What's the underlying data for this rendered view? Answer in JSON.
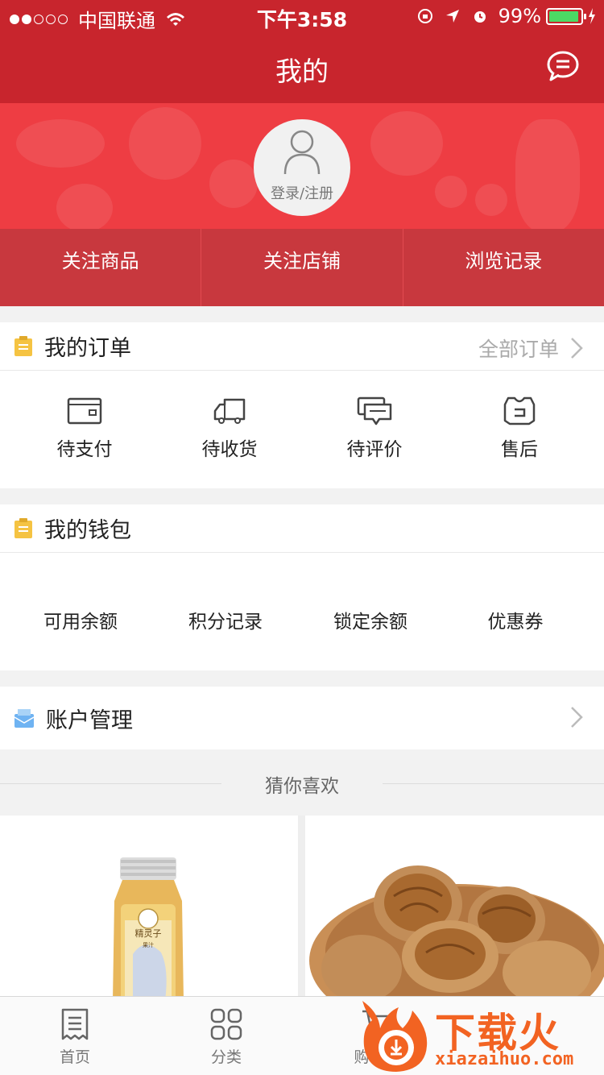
{
  "status_bar": {
    "carrier": "中国联通",
    "time": "下午3:58",
    "battery": "99%"
  },
  "header": {
    "title": "我的"
  },
  "profile": {
    "login_label": "登录/注册"
  },
  "follow_bar": [
    {
      "label": "关注商品"
    },
    {
      "label": "关注店铺"
    },
    {
      "label": "浏览记录"
    }
  ],
  "orders": {
    "title": "我的订单",
    "all_label": "全部订单",
    "items": [
      {
        "label": "待支付",
        "icon": "wallet-icon"
      },
      {
        "label": "待收货",
        "icon": "truck-icon"
      },
      {
        "label": "待评价",
        "icon": "comment-icon"
      },
      {
        "label": "售后",
        "icon": "aftersale-icon"
      }
    ]
  },
  "wallet": {
    "title": "我的钱包",
    "items": [
      {
        "label": "可用余额"
      },
      {
        "label": "积分记录"
      },
      {
        "label": "锁定余额"
      },
      {
        "label": "优惠券"
      }
    ]
  },
  "account": {
    "title": "账户管理"
  },
  "recommend": {
    "title": "猜你喜欢"
  },
  "products": [
    {
      "label": "精灵子",
      "sub": "果汁"
    },
    {
      "label": ""
    }
  ],
  "tabbar": [
    {
      "label": "首页",
      "icon": "home-list-icon"
    },
    {
      "label": "分类",
      "icon": "category-grid-icon"
    },
    {
      "label": "购物车",
      "icon": "cart-icon"
    }
  ],
  "watermark": {
    "text": "下载火",
    "sub": "xiazaihuo.com"
  },
  "colors": {
    "brand_red": "#c8252d",
    "banner_red": "#ee3d43",
    "accent_yellow": "#f5c342",
    "watermark_orange": "#f26322"
  }
}
